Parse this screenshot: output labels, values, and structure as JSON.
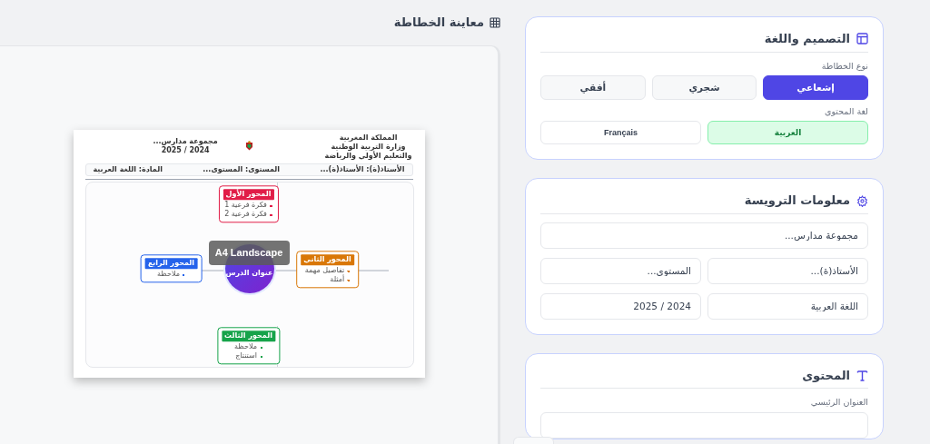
{
  "preview": {
    "title": "معاينة الخطاطة",
    "paper_label": "A4 Landscape",
    "header_right": [
      "المملكة المغربية",
      "وزارة التربية الوطنية",
      "والتعليم الأولي والرياضة"
    ],
    "header_left": [
      "مجموعة مدارس...",
      "2024 / 2025"
    ],
    "info_bar": [
      "الأستاذ(ة): الأستاذ(ة)...",
      "المستوى: المستوى...",
      "المادة: اللغة العربية"
    ],
    "center": "عنوان الدرس",
    "branches": [
      {
        "title": "المحور الأول",
        "color": "#e11d48",
        "items": [
          "فكرة فرعية 1",
          "فكرة فرعية 2"
        ]
      },
      {
        "title": "المحور الثاني",
        "color": "#d97706",
        "items": [
          "تفاصيل مهمة",
          "أمثلة"
        ]
      },
      {
        "title": "المحور الثالث",
        "color": "#16a34a",
        "items": [
          "ملاحظة",
          "استنتاج"
        ]
      },
      {
        "title": "المحور الرابع",
        "color": "#2563eb",
        "items": [
          "ملاحظة"
        ]
      }
    ]
  },
  "design_card": {
    "title": "التصميم واللغة",
    "layout_type": {
      "label": "نوع الخطاطة",
      "options": [
        {
          "label": "إشعاعي",
          "selected": true
        },
        {
          "label": "شجري",
          "selected": false
        },
        {
          "label": "أفقي",
          "selected": false
        }
      ]
    },
    "content_language": {
      "label": "لغة المحتوى",
      "options": [
        {
          "label": "العربية",
          "selected": true
        },
        {
          "label": "Français",
          "selected": false
        }
      ]
    }
  },
  "header_card": {
    "title": "معلومات الترويسة",
    "rows": [
      [
        {
          "value": "مجموعة مدارس..."
        }
      ],
      [
        {
          "value": "الأستاذ(ة)..."
        },
        {
          "value": "المستوى..."
        }
      ],
      [
        {
          "value": "اللغة العربية"
        },
        {
          "value": "2024 / 2025"
        }
      ]
    ]
  },
  "content_card": {
    "title": "المحتوى",
    "field_label": "العنوان الرئيسي"
  }
}
